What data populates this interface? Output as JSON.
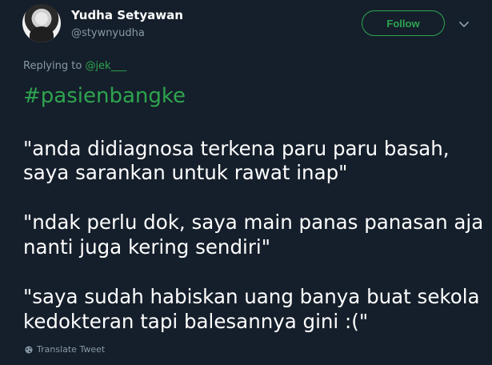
{
  "author": {
    "display_name": "Yudha Setyawan",
    "username": "@stywnyudha",
    "avatar_icon": "avatar-photo"
  },
  "actions": {
    "follow_label": "Follow",
    "more_icon": "chevron-down-icon"
  },
  "reply": {
    "prefix": "Replying to ",
    "handle": "@jek___"
  },
  "tweet": {
    "hashtag": "#pasienbangke",
    "lines": [
      "\"anda didiagnosa terkena paru paru basah,",
      "saya sarankan untuk rawat inap\"",
      "\"ndak perlu dok, saya main panas panasan aja",
      "nanti juga kering sendiri\"",
      "\"saya sudah habiskan uang banya buat sekola",
      "kedokteran tapi balesannya gini :(\""
    ]
  },
  "footer": {
    "translate_label": "Translate Tweet",
    "translate_icon": "globe-icon"
  },
  "colors": {
    "background": "#151f2b",
    "accent": "#2ea44f",
    "muted": "#8899a6",
    "text": "#ffffff"
  }
}
